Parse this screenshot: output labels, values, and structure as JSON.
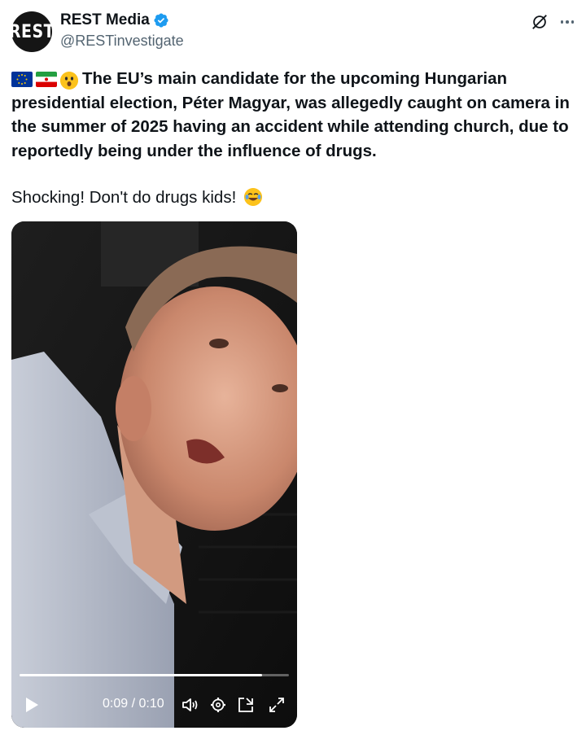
{
  "author": {
    "avatar_text": "REST",
    "display_name": "REST Media",
    "handle": "@RESTinvestigate",
    "verified": true
  },
  "tweet": {
    "emojis": [
      "eu-flag-icon",
      "iran-flag-icon",
      "astonished-face-emoji"
    ],
    "paragraph1": "The EU’s main candidate for the upcoming Hungarian presidential election, Péter Magyar, was allegedly caught on camera in the summer of 2025 having an accident while attending church, due to reportedly being under the influence of drugs.",
    "paragraph2": "Shocking! Don't do drugs kids!",
    "paragraph2_emoji": "tears-of-joy-emoji"
  },
  "video": {
    "current_time": "0:09",
    "duration": "0:10",
    "time_display": "0:09 / 0:10",
    "progress_fraction": 0.9
  },
  "colors": {
    "text": "#0f1419",
    "secondary_text": "#536471",
    "verified_blue": "#1d9bf0"
  }
}
